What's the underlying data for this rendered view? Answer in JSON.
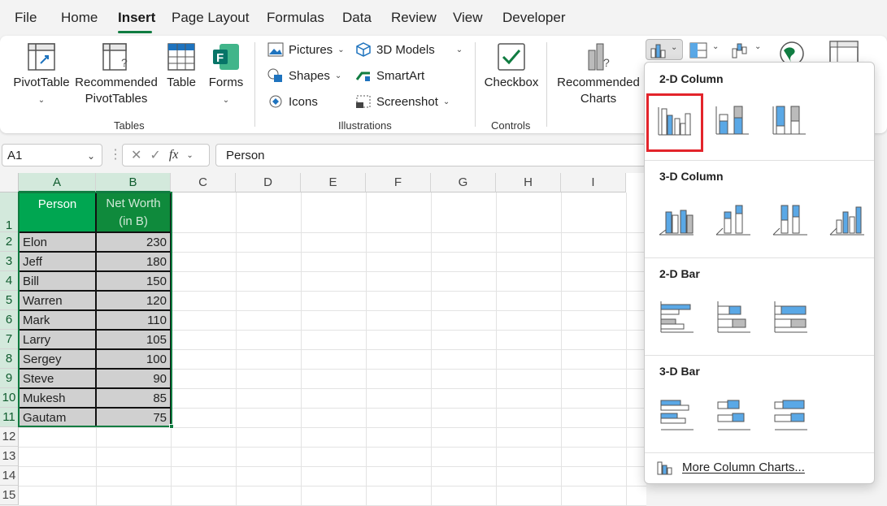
{
  "menu": {
    "tabs": [
      "File",
      "Home",
      "Insert",
      "Page Layout",
      "Formulas",
      "Data",
      "Review",
      "View",
      "Developer"
    ],
    "active": "Insert"
  },
  "ribbon": {
    "pivottable": "PivotTable",
    "recommended_pivot_line1": "Recommended",
    "recommended_pivot_line2": "PivotTables",
    "table": "Table",
    "forms": "Forms",
    "tables_group": "Tables",
    "pictures": "Pictures",
    "shapes": "Shapes",
    "icons": "Icons",
    "models3d": "3D Models",
    "smartart": "SmartArt",
    "screenshot": "Screenshot",
    "illustrations_group": "Illustrations",
    "checkbox": "Checkbox",
    "controls_group": "Controls",
    "recommended_charts_line1": "Recommended",
    "recommended_charts_line2": "Charts"
  },
  "formula_bar": {
    "name_box": "A1",
    "fx": "fx",
    "content": "Person"
  },
  "columns": [
    "A",
    "B",
    "C",
    "D",
    "E",
    "F",
    "G",
    "H",
    "I"
  ],
  "rows": [
    "1",
    "2",
    "3",
    "4",
    "5",
    "6",
    "7",
    "8",
    "9",
    "10",
    "11",
    "12",
    "13",
    "14",
    "15"
  ],
  "table": {
    "header_person": "Person",
    "header_networth_line1": "Net Worth",
    "header_networth_line2": "(in B)",
    "rows": [
      {
        "name": "Elon",
        "value": "230"
      },
      {
        "name": "Jeff",
        "value": "180"
      },
      {
        "name": "Bill",
        "value": "150"
      },
      {
        "name": "Warren",
        "value": "120"
      },
      {
        "name": "Mark",
        "value": "110"
      },
      {
        "name": "Larry",
        "value": "105"
      },
      {
        "name": "Sergey",
        "value": "100"
      },
      {
        "name": "Steve",
        "value": "90"
      },
      {
        "name": "Mukesh",
        "value": "85"
      },
      {
        "name": "Gautam",
        "value": "75"
      }
    ]
  },
  "dropdown": {
    "sections": [
      "2-D Column",
      "3-D Column",
      "2-D Bar",
      "3-D Bar"
    ],
    "more": "More Column Charts..."
  },
  "colors": {
    "accent": "#107c41",
    "header_fill": "#00a651",
    "header_fill_dark": "#0f8a3c",
    "data_fill": "#d0d0d0",
    "highlight": "#e3242b",
    "chart_blue": "#5aa8e6"
  }
}
